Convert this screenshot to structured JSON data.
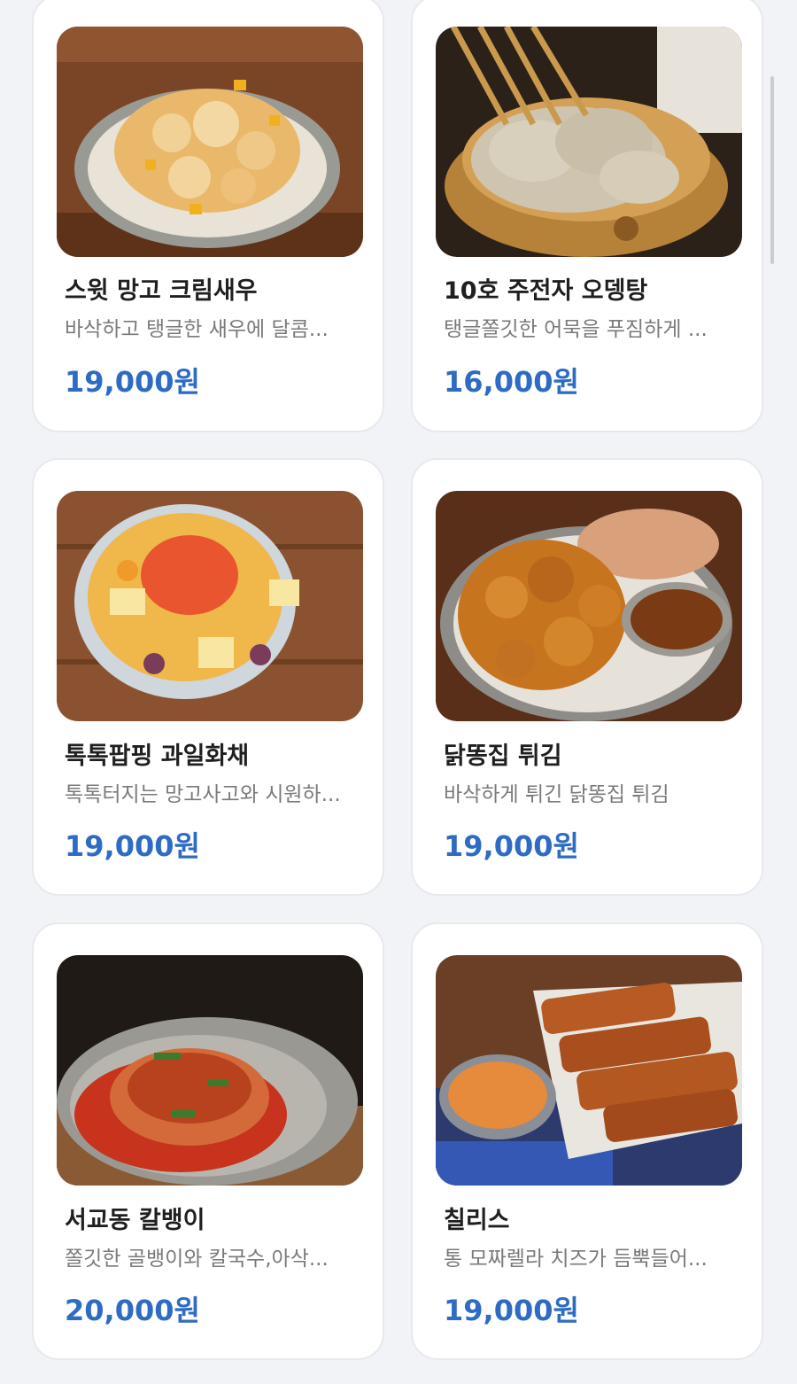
{
  "menu_items": [
    {
      "name": "스윗 망고 크림새우",
      "description": "바삭하고 탱글한 새우에 달콤...",
      "price": "19,000원",
      "image_icon": "fried-shrimp-mango-photo"
    },
    {
      "name": "10호 주전자 오뎅탕",
      "description": "탱글쫄깃한 어묵을 푸짐하게 ...",
      "price": "16,000원",
      "image_icon": "fishcake-soup-photo"
    },
    {
      "name": "톡톡팝핑 과일화채",
      "description": "톡톡터지는 망고사고와 시원하...",
      "price": "19,000원",
      "image_icon": "fruit-punch-photo"
    },
    {
      "name": "닭똥집 튀김",
      "description": "바삭하게 튀긴 닭똥집 튀김",
      "price": "19,000원",
      "image_icon": "fried-gizzard-photo"
    },
    {
      "name": "서교동 칼뱅이",
      "description": "쫄깃한 골뱅이와 칼국수,아삭...",
      "price": "20,000원",
      "image_icon": "spicy-sea-snail-noodle-photo"
    },
    {
      "name": "칠리스",
      "description": "통 모짜렐라 치즈가 듬뿍들어...",
      "price": "19,000원",
      "image_icon": "cheese-sticks-photo"
    }
  ],
  "colors": {
    "price": "#2e6bc4",
    "background": "#f2f3f6",
    "card": "#ffffff"
  }
}
